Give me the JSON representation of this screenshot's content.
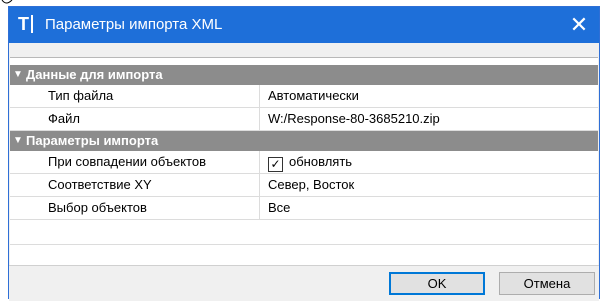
{
  "window": {
    "app_icon_label": "T",
    "title": "Параметры импорта XML",
    "close_symbol": "✕"
  },
  "grid": {
    "categories": [
      {
        "label": "Данные для импорта",
        "rows": [
          {
            "name": "Тип файла",
            "value": "Автоматически"
          },
          {
            "name": "Файл",
            "value": "W:/Response-80-3685210.zip"
          }
        ]
      },
      {
        "label": "Параметры импорта",
        "rows": [
          {
            "name": "При совпадении объектов",
            "value": "обновлять",
            "checked": true
          },
          {
            "name": "Соответствие XY",
            "value": "Север, Восток"
          },
          {
            "name": "Выбор объектов",
            "value": "Все"
          }
        ]
      }
    ]
  },
  "buttons": {
    "ok_label": "OK",
    "cancel_label": "Отмена"
  },
  "colors": {
    "titlebar": "#1e6fd9",
    "category_header": "#8c8c8c"
  }
}
